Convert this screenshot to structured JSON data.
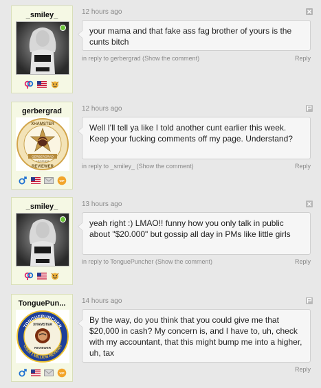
{
  "comments": [
    {
      "username": "_smiley_",
      "avatar_icon": "user-photo",
      "time": "12 hours ago",
      "action_icon": "close-icon",
      "text": "your mama and that fake ass fag brother of yours is the cunts bitch",
      "in_reply_to_prefix": "in reply to",
      "in_reply_to_user": "gerbergrad",
      "show_comment": "(Show the comment)",
      "reply": "Reply",
      "badges": [
        "couple-icon",
        "us-flag-icon",
        "friend-icon"
      ]
    },
    {
      "username": "gerbergrad",
      "avatar_icon": "xhamster-reviewer-badge",
      "time": "12 hours ago",
      "action_icon": "flag-icon",
      "text": "Well I'll tell ya like I told another cunt earlier this week. Keep your fucking comments off my page. Understand?",
      "in_reply_to_prefix": "in reply to",
      "in_reply_to_user": "_smiley_",
      "show_comment": "(Show the comment)",
      "reply": "Reply",
      "badges": [
        "male-icon",
        "us-flag-icon",
        "mail-icon",
        "vip-icon"
      ]
    },
    {
      "username": "_smiley_",
      "avatar_icon": "user-photo",
      "time": "13 hours ago",
      "action_icon": "close-icon",
      "text": "yeah right :) LMAO!! funny how you only talk in public about \"$20.000\" but gossip all day in PMs like little girls",
      "in_reply_to_prefix": "in reply to",
      "in_reply_to_user": "TonguePuncher",
      "show_comment": "(Show the comment)",
      "reply": "Reply",
      "badges": [
        "couple-icon",
        "us-flag-icon",
        "friend-icon"
      ]
    },
    {
      "username": "TonguePun...",
      "avatar_icon": "tonguepuncher-reviews-badge",
      "time": "14 hours ago",
      "action_icon": "flag-icon",
      "text": "By the way, do you think that you could give me that $20,000 in cash? My concern is, and I have to, uh, check with my accountant, that this might bump me into a higher, uh, tax",
      "in_reply_to_prefix": "",
      "in_reply_to_user": "",
      "show_comment": "",
      "reply": "Reply",
      "badges": [
        "male-icon",
        "us-flag-icon",
        "mail-icon",
        "vip-icon"
      ]
    }
  ],
  "badge_text": {
    "gerbergrad_top": "XHAMSTER",
    "gerbergrad_name": "GERBERGRAD",
    "gerbergrad_rank": "LEGENDS",
    "gerbergrad_bottom": "REVIEWER",
    "tp_top": "TONGUEPUNCHER",
    "tp_mid": "XHAMSTER",
    "tp_reviewer": "REVIEWER",
    "tp_bottom": "OVER 1 MILLION REVIEWS",
    "vip": "VIP"
  },
  "colors": {
    "card_bg": "#f5f8e4",
    "bubble_bg": "#f6f6f6",
    "meta_text": "#888888",
    "online": "#6cc33b"
  }
}
